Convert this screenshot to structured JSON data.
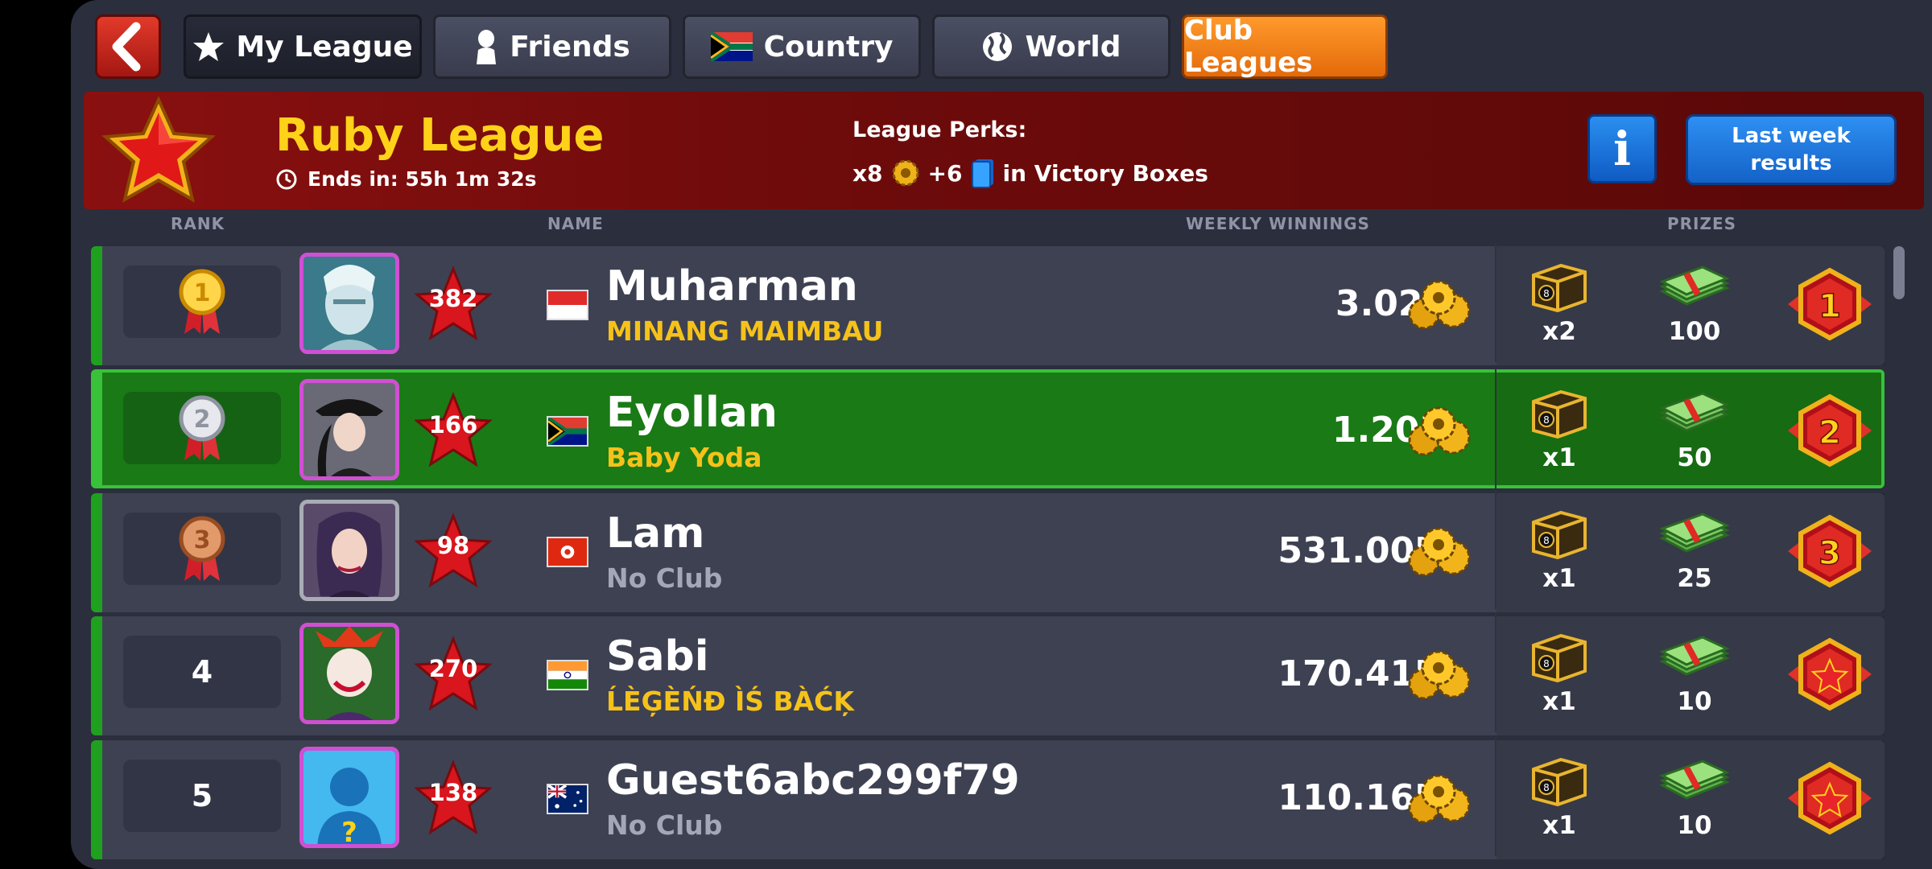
{
  "nav": {
    "tabs": [
      {
        "label": "My League",
        "icon": "star-icon",
        "active": true
      },
      {
        "label": "Friends",
        "icon": "person-silhouette-icon",
        "active": false
      },
      {
        "label": "Country",
        "icon": "south-africa-flag-icon",
        "active": false
      },
      {
        "label": "World",
        "icon": "globe-icon",
        "active": false
      }
    ],
    "club_leagues_label": "Club Leagues"
  },
  "league": {
    "name": "Ruby League",
    "ends_in": "Ends in: 55h 1m 32s",
    "perks_title": "League Perks:",
    "perk_cue_multiplier": "x8",
    "perk_cards": "+6",
    "perk_suffix": "in Victory Boxes",
    "info_label": "i",
    "last_week_label": "Last week results"
  },
  "columns": {
    "rank": "RANK",
    "name": "NAME",
    "winnings": "WEEKLY WINNINGS",
    "prizes": "PRIZES"
  },
  "players": [
    {
      "rank": "1",
      "medal": "gold",
      "level": "382",
      "flag": "indonesia",
      "name": "Muharman",
      "club": "MINANG MAIMBAU",
      "club_none": false,
      "winnings": "3.02B",
      "box_count": "x2",
      "cash": "100",
      "badge": "1",
      "highlight": false
    },
    {
      "rank": "2",
      "medal": "silver",
      "level": "166",
      "flag": "south-africa",
      "name": "Eyollan",
      "club": "Baby Yoda",
      "club_none": false,
      "winnings": "1.20B",
      "box_count": "x1",
      "cash": "50",
      "badge": "2",
      "highlight": true
    },
    {
      "rank": "3",
      "medal": "bronze",
      "level": "98",
      "flag": "hong-kong",
      "name": "Lam",
      "club": "No Club",
      "club_none": true,
      "winnings": "531.00M",
      "box_count": "x1",
      "cash": "25",
      "badge": "3",
      "highlight": false
    },
    {
      "rank": "4",
      "medal": "",
      "level": "270",
      "flag": "india",
      "name": "Sabi",
      "club": "ĹÈĢÈŃĐ ÌŚ BÀĆĶ",
      "club_none": false,
      "winnings": "170.41M",
      "box_count": "x1",
      "cash": "10",
      "badge": "",
      "highlight": false
    },
    {
      "rank": "5",
      "medal": "",
      "level": "138",
      "flag": "australia",
      "name": "Guest6abc299f79",
      "club": "No Club",
      "club_none": true,
      "winnings": "110.16M",
      "box_count": "x1",
      "cash": "10",
      "badge": "",
      "highlight": false
    }
  ],
  "colors": {
    "ruby": "#8a1010",
    "gold_text": "#ffd21a",
    "highlight_row": "#1a7a16",
    "club_button": "#f5861a",
    "info_blue": "#1f78e0"
  }
}
